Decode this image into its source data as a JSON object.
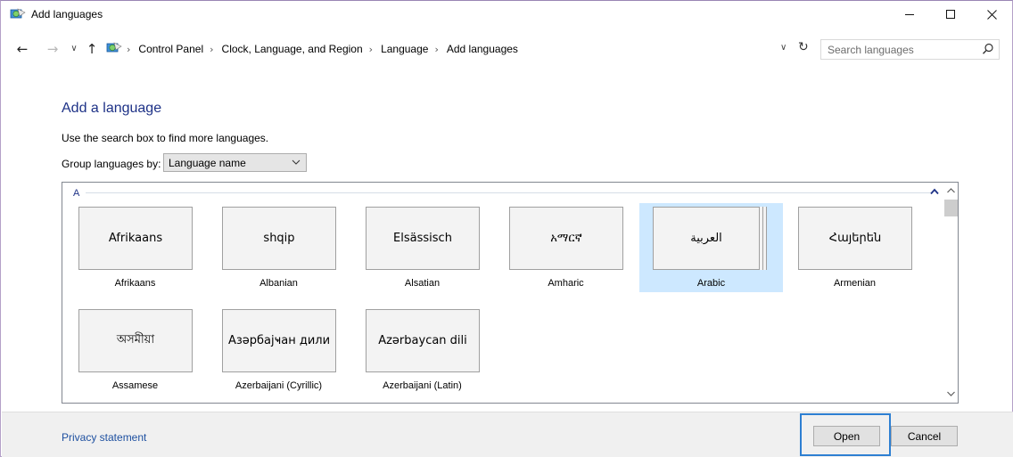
{
  "window": {
    "title": "Add languages",
    "icon": "control-panel-globe-icon",
    "controls": [
      "minimize-icon",
      "maximize-icon",
      "close-icon"
    ]
  },
  "address_bar": {
    "breadcrumbs": [
      "Control Panel",
      "Clock, Language, and Region",
      "Language",
      "Add languages"
    ],
    "search_placeholder": "Search languages"
  },
  "content": {
    "heading": "Add a language",
    "hint": "Use the search box to find more languages.",
    "group_by_label": "Group languages by:",
    "group_by_value": "Language name"
  },
  "language_list": {
    "group_letter": "A",
    "languages": [
      {
        "native": "Afrikaans",
        "name": "Afrikaans",
        "selected": false
      },
      {
        "native": "shqip",
        "name": "Albanian",
        "selected": false
      },
      {
        "native": "Elsässisch",
        "name": "Alsatian",
        "selected": false
      },
      {
        "native": "አማርኛ",
        "name": "Amharic",
        "selected": false
      },
      {
        "native": "العربية",
        "name": "Arabic",
        "selected": true
      },
      {
        "native": "Հայերեն",
        "name": "Armenian",
        "selected": false
      },
      {
        "native": "অসমীয়া",
        "name": "Assamese",
        "selected": false
      },
      {
        "native": "Азәрбајҹан дили",
        "name": "Azerbaijani (Cyrillic)",
        "selected": false
      },
      {
        "native": "Azərbaycan dili",
        "name": "Azerbaijani (Latin)",
        "selected": false
      }
    ]
  },
  "footer": {
    "privacy_link": "Privacy statement",
    "open_label": "Open",
    "cancel_label": "Cancel"
  },
  "colors": {
    "heading": "#1e3287",
    "link": "#1e50a0",
    "selection": "#cde8ff",
    "focus_border": "#2d7fd2"
  }
}
